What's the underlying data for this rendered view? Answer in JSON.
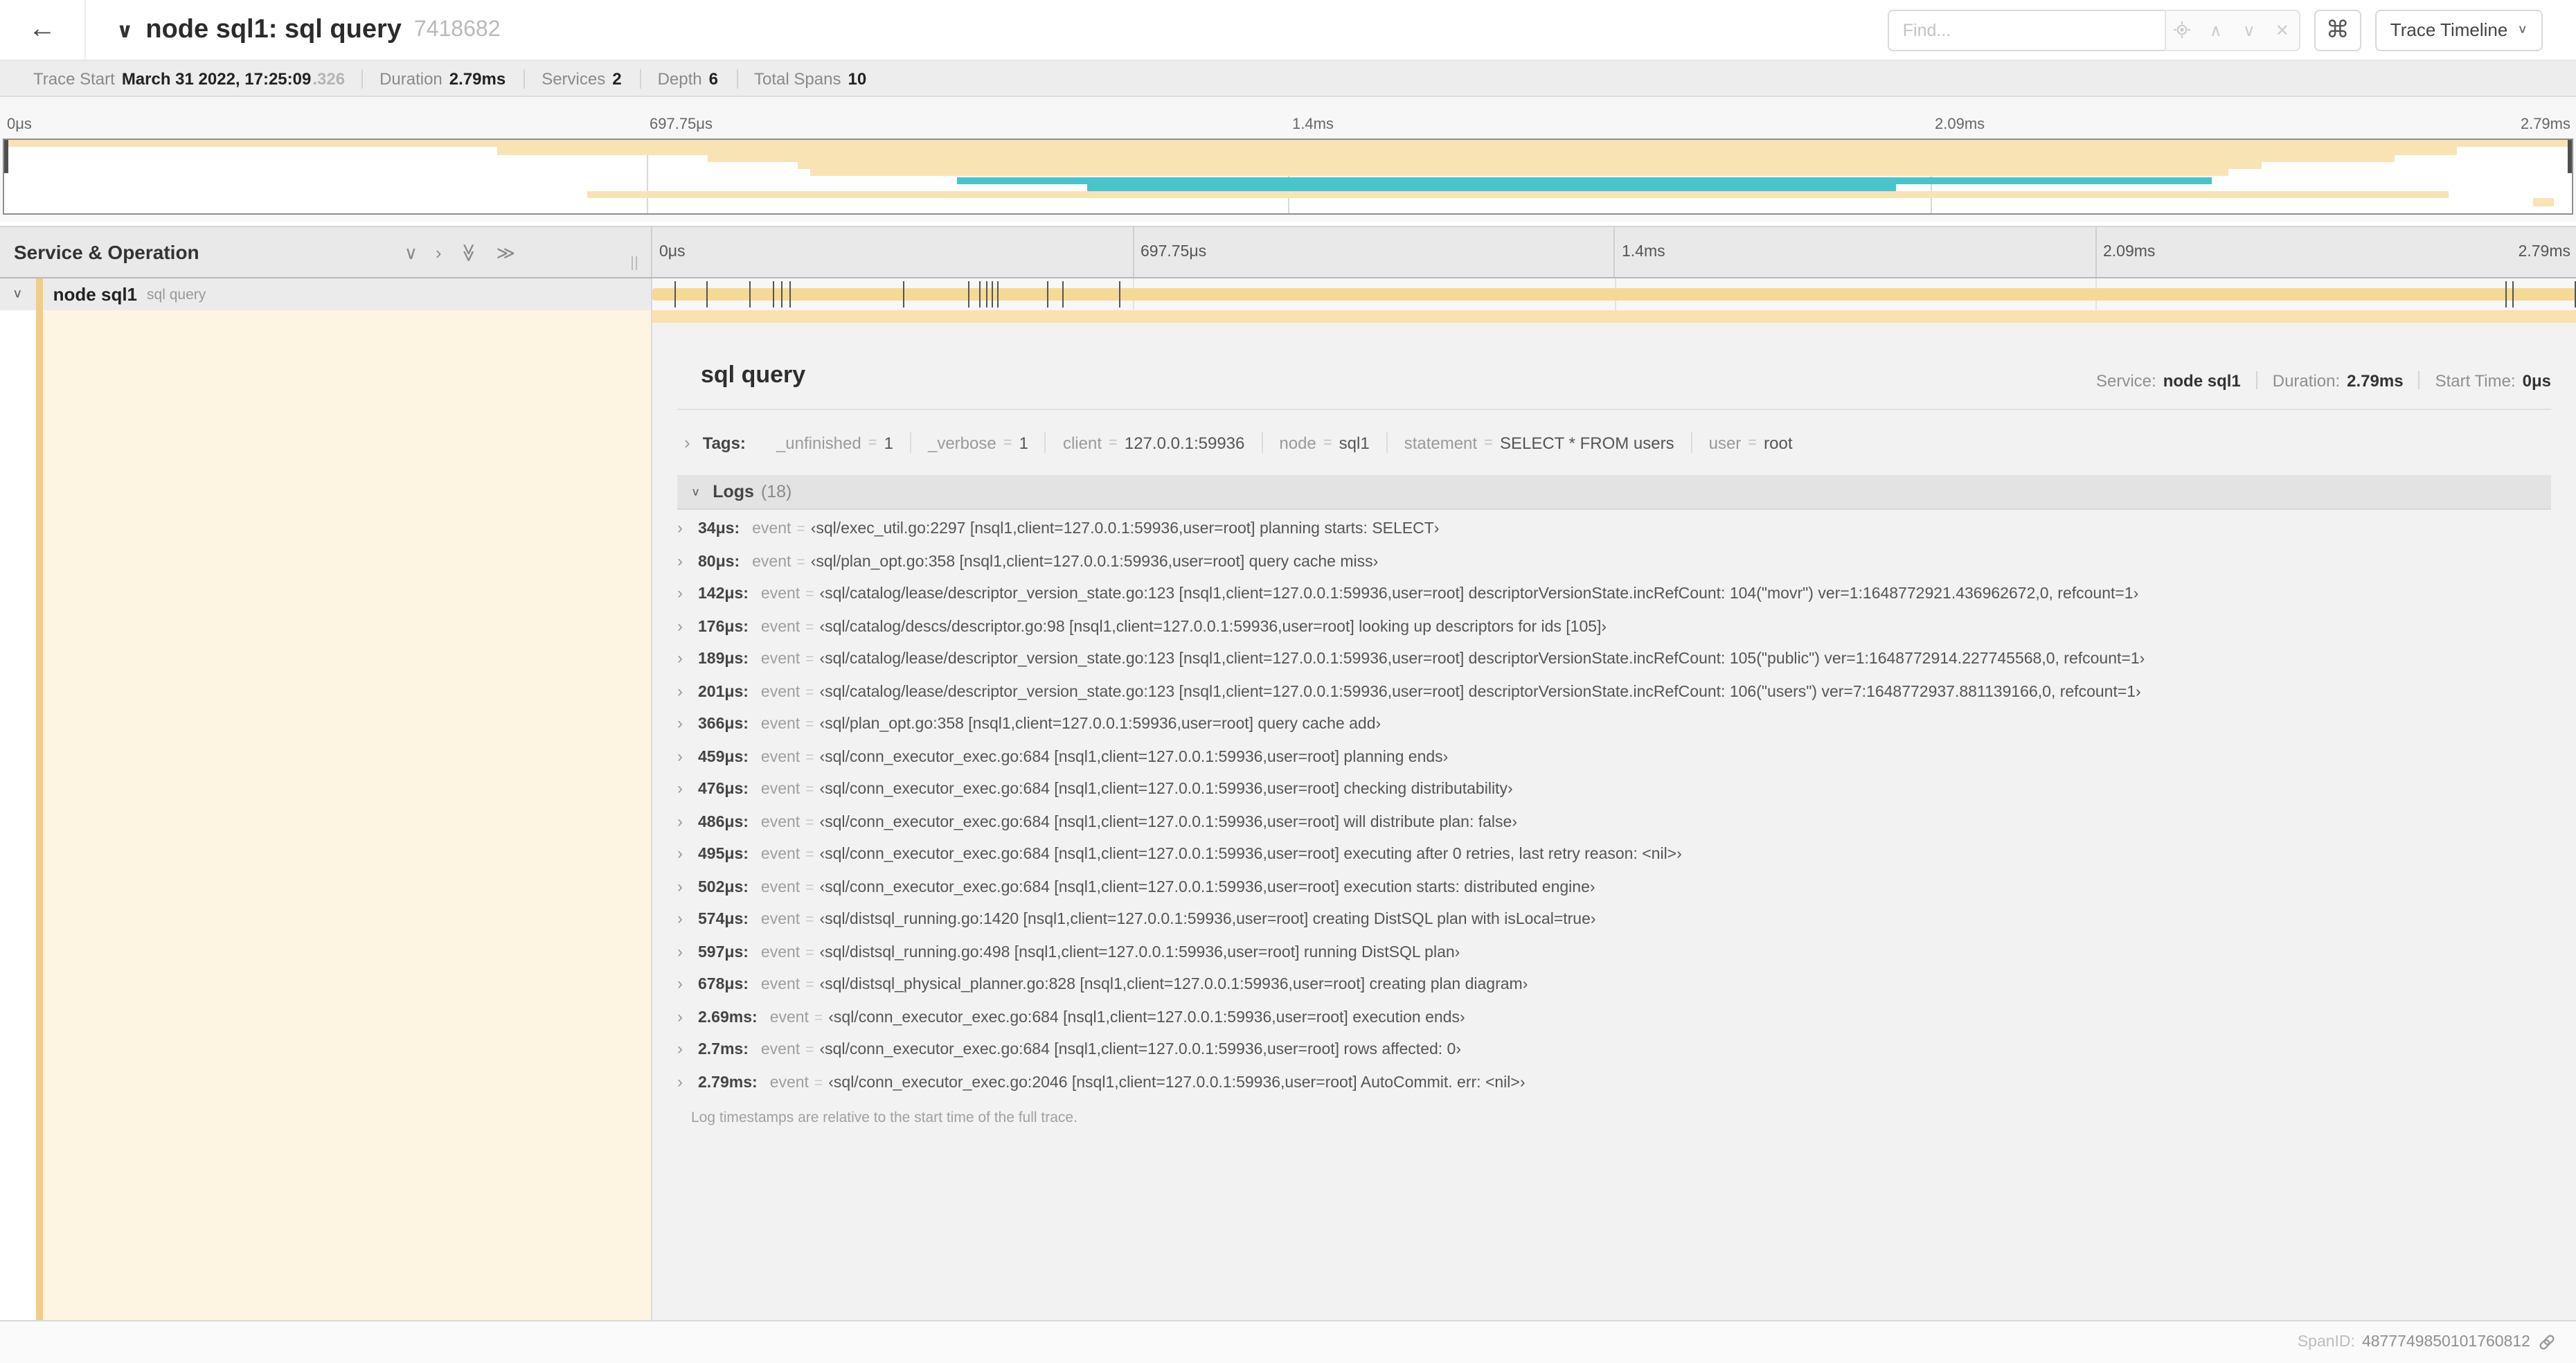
{
  "icons": {
    "back": "←",
    "chevron_down": "∨",
    "chevron_up": "∧",
    "chevron_right": "›",
    "double_chevron": "≫",
    "close": "✕",
    "command": "⌘"
  },
  "header": {
    "title": "node sql1: sql query",
    "trace_id_short": "7418682",
    "find_placeholder": "Find...",
    "view_selector": "Trace Timeline"
  },
  "summary": {
    "items": [
      {
        "label": "Trace Start",
        "value": "March 31 2022, 17:25:09",
        "suffix": ".326"
      },
      {
        "label": "Duration",
        "value": "2.79ms"
      },
      {
        "label": "Services",
        "value": "2"
      },
      {
        "label": "Depth",
        "value": "6"
      },
      {
        "label": "Total Spans",
        "value": "10"
      }
    ]
  },
  "ruler_ticks": [
    "0μs",
    "697.75μs",
    "1.4ms",
    "2.09ms",
    "2.79ms"
  ],
  "minimap": {
    "colors": {
      "orange": "#f8e3b4",
      "teal": "#48c5cb"
    },
    "spans": [
      {
        "start": 0.0,
        "end": 1.0,
        "color": "orange"
      },
      {
        "start": 0.192,
        "end": 0.955,
        "color": "orange"
      },
      {
        "start": 0.274,
        "end": 0.931,
        "color": "orange"
      },
      {
        "start": 0.309,
        "end": 0.879,
        "color": "orange"
      },
      {
        "start": 0.314,
        "end": 0.866,
        "color": "orange"
      },
      {
        "start": 0.371,
        "end": 0.86,
        "color": "teal"
      },
      {
        "start": 0.422,
        "end": 0.737,
        "color": "teal"
      },
      {
        "start": 0.227,
        "end": 0.952,
        "color": "orange"
      },
      {
        "start": 0.985,
        "end": 0.993,
        "color": "orange"
      },
      {
        "start": 0.0,
        "end": 0.0,
        "color": "orange"
      }
    ]
  },
  "timeline_header": {
    "left_title": "Service & Operation"
  },
  "span_row": {
    "service": "node sql1",
    "operation": "sql query",
    "total_us": 2790,
    "tick_times_us": [
      34,
      80,
      142,
      176,
      189,
      201,
      366,
      459,
      476,
      486,
      495,
      502,
      574,
      597,
      678,
      2690,
      2700,
      2790
    ]
  },
  "detail": {
    "head": {
      "title": "sql query",
      "service_label": "Service:",
      "service_value": "node sql1",
      "duration_label": "Duration:",
      "duration_value": "2.79ms",
      "start_label": "Start Time:",
      "start_value": "0μs"
    },
    "tags": {
      "label": "Tags:",
      "eq": "=",
      "items": [
        {
          "key": "_unfinished",
          "value": "1"
        },
        {
          "key": "_verbose",
          "value": "1"
        },
        {
          "key": "client",
          "value": "127.0.0.1:59936"
        },
        {
          "key": "node",
          "value": "sql1"
        },
        {
          "key": "statement",
          "value": "SELECT * FROM users"
        },
        {
          "key": "user",
          "value": "root"
        }
      ]
    },
    "logs": {
      "label": "Logs",
      "count": "(18)",
      "key_label": "event",
      "eq": "=",
      "items": [
        {
          "t": "34μs:",
          "v": "‹sql/exec_util.go:2297 [nsql1,client=127.0.0.1:59936,user=root] planning starts: SELECT›"
        },
        {
          "t": "80μs:",
          "v": "‹sql/plan_opt.go:358 [nsql1,client=127.0.0.1:59936,user=root] query cache miss›"
        },
        {
          "t": "142μs:",
          "v": "‹sql/catalog/lease/descriptor_version_state.go:123 [nsql1,client=127.0.0.1:59936,user=root] descriptorVersionState.incRefCount: 104(\"movr\") ver=1:1648772921.436962672,0, refcount=1›"
        },
        {
          "t": "176μs:",
          "v": "‹sql/catalog/descs/descriptor.go:98 [nsql1,client=127.0.0.1:59936,user=root] looking up descriptors for ids [105]›"
        },
        {
          "t": "189μs:",
          "v": "‹sql/catalog/lease/descriptor_version_state.go:123 [nsql1,client=127.0.0.1:59936,user=root] descriptorVersionState.incRefCount: 105(\"public\") ver=1:1648772914.227745568,0, refcount=1›"
        },
        {
          "t": "201μs:",
          "v": "‹sql/catalog/lease/descriptor_version_state.go:123 [nsql1,client=127.0.0.1:59936,user=root] descriptorVersionState.incRefCount: 106(\"users\") ver=7:1648772937.881139166,0, refcount=1›"
        },
        {
          "t": "366μs:",
          "v": "‹sql/plan_opt.go:358 [nsql1,client=127.0.0.1:59936,user=root] query cache add›"
        },
        {
          "t": "459μs:",
          "v": "‹sql/conn_executor_exec.go:684 [nsql1,client=127.0.0.1:59936,user=root] planning ends›"
        },
        {
          "t": "476μs:",
          "v": "‹sql/conn_executor_exec.go:684 [nsql1,client=127.0.0.1:59936,user=root] checking distributability›"
        },
        {
          "t": "486μs:",
          "v": "‹sql/conn_executor_exec.go:684 [nsql1,client=127.0.0.1:59936,user=root] will distribute plan: false›"
        },
        {
          "t": "495μs:",
          "v": "‹sql/conn_executor_exec.go:684 [nsql1,client=127.0.0.1:59936,user=root] executing after 0 retries, last retry reason: <nil>›"
        },
        {
          "t": "502μs:",
          "v": "‹sql/conn_executor_exec.go:684 [nsql1,client=127.0.0.1:59936,user=root] execution starts: distributed engine›"
        },
        {
          "t": "574μs:",
          "v": "‹sql/distsql_running.go:1420 [nsql1,client=127.0.0.1:59936,user=root] creating DistSQL plan with isLocal=true›"
        },
        {
          "t": "597μs:",
          "v": "‹sql/distsql_running.go:498 [nsql1,client=127.0.0.1:59936,user=root] running DistSQL plan›"
        },
        {
          "t": "678μs:",
          "v": "‹sql/distsql_physical_planner.go:828 [nsql1,client=127.0.0.1:59936,user=root] creating plan diagram›"
        },
        {
          "t": "2.69ms:",
          "v": "‹sql/conn_executor_exec.go:684 [nsql1,client=127.0.0.1:59936,user=root] execution ends›"
        },
        {
          "t": "2.7ms:",
          "v": "‹sql/conn_executor_exec.go:684 [nsql1,client=127.0.0.1:59936,user=root] rows affected: 0›"
        },
        {
          "t": "2.79ms:",
          "v": "‹sql/conn_executor_exec.go:2046 [nsql1,client=127.0.0.1:59936,user=root] AutoCommit. err: <nil>›"
        }
      ]
    },
    "footer_note": "Log timestamps are relative to the start time of the full trace.",
    "span_id_label": "SpanID:",
    "span_id": "4877749850101760812"
  }
}
